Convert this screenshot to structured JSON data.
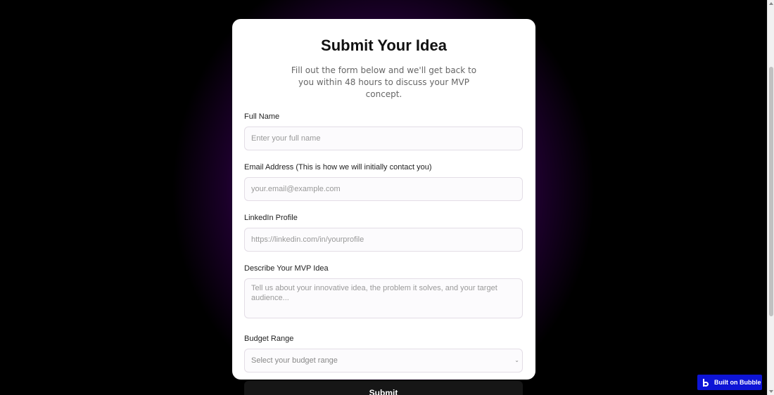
{
  "form": {
    "title": "Submit Your Idea",
    "subtitle": "Fill out the form below and we'll get back to you within 48 hours to discuss your MVP concept.",
    "fields": [
      {
        "label": "Full Name",
        "placeholder": "Enter your full name",
        "value": ""
      },
      {
        "label": "Email Address (This is how we will initially contact you)",
        "placeholder": "your.email@example.com",
        "value": ""
      },
      {
        "label": "LinkedIn Profile",
        "placeholder": "https://linkedin.com/in/yourprofile",
        "value": ""
      },
      {
        "label": "Describe Your MVP Idea",
        "placeholder": "Tell us about your innovative idea, the problem it solves, and your target audience...",
        "value": ""
      }
    ],
    "budget": {
      "label": "Budget Range",
      "selected": "Select your budget range"
    },
    "submit_label": "Submit"
  },
  "badge": {
    "label": "Built on Bubble",
    "icon": "bubble-logo-icon",
    "color": "#0d14d6"
  },
  "colors": {
    "accent": "#6a0a9c",
    "button": "#161616"
  }
}
